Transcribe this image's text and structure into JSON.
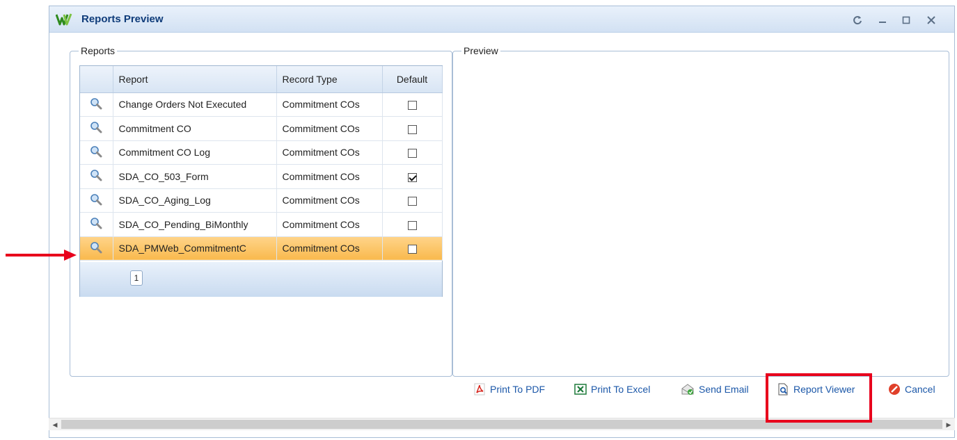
{
  "window": {
    "title": "Reports Preview"
  },
  "reports_group": {
    "legend": "Reports",
    "columns": [
      "Report",
      "Record Type",
      "Default"
    ],
    "rows": [
      {
        "report": "Change Orders Not Executed",
        "record_type": "Commitment COs",
        "default": false
      },
      {
        "report": "Commitment CO",
        "record_type": "Commitment COs",
        "default": false
      },
      {
        "report": "Commitment CO Log",
        "record_type": "Commitment COs",
        "default": false
      },
      {
        "report": "SDA_CO_503_Form",
        "record_type": "Commitment COs",
        "default": true
      },
      {
        "report": "SDA_CO_Aging_Log",
        "record_type": "Commitment COs",
        "default": false
      },
      {
        "report": "SDA_CO_Pending_BiMonthly",
        "record_type": "Commitment COs",
        "default": false
      },
      {
        "report": "SDA_PMWeb_CommitmentC",
        "record_type": "Commitment COs",
        "default": false
      }
    ],
    "selected_row": 6,
    "pager": {
      "current_page": "1"
    }
  },
  "preview_group": {
    "legend": "Preview"
  },
  "actions": {
    "print_pdf": "Print To PDF",
    "print_excel": "Print To Excel",
    "send_email": "Send Email",
    "report_viewer": "Report Viewer",
    "cancel": "Cancel"
  },
  "colors": {
    "title": "#0f3c7a",
    "link": "#1b57a8",
    "selected_row": "#f9b94d",
    "annotation": "#e8001c"
  }
}
